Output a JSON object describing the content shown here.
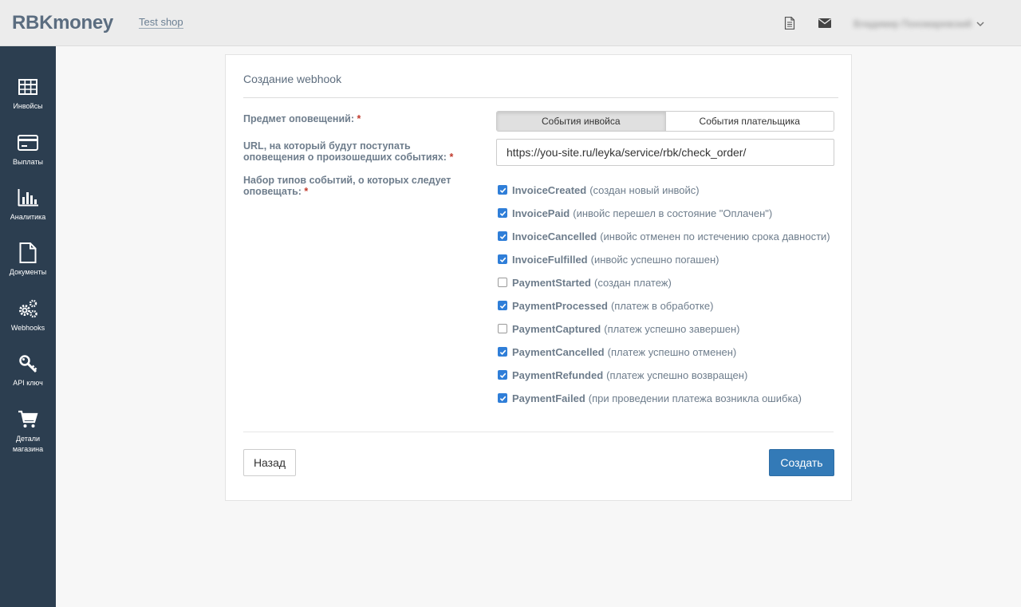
{
  "header": {
    "logo": "RBKmoney",
    "shop_link": "Test shop",
    "user_name": "Владимир Пономаревский",
    "icons": [
      "document-icon",
      "mail-icon",
      "chevron-down-icon"
    ]
  },
  "sidebar": {
    "items": [
      {
        "label": "Инвойсы",
        "icon": "table-icon"
      },
      {
        "label": "Выплаты",
        "icon": "credit-card-icon"
      },
      {
        "label": "Аналитика",
        "icon": "bar-chart-icon"
      },
      {
        "label": "Документы",
        "icon": "document-icon"
      },
      {
        "label": "Webhooks",
        "icon": "gears-icon"
      },
      {
        "label": "API ключ",
        "icon": "key-icon"
      },
      {
        "label": "Детали магазина",
        "icon": "cart-icon"
      }
    ]
  },
  "form": {
    "title": "Создание webhook",
    "subject_label": "Предмет оповещений:",
    "url_label": "URL, на который будут поступать оповещения о произошедших событиях:",
    "events_label": "Набор типов событий, о которых следует оповещать:",
    "required_mark": "*",
    "subject_options": [
      {
        "label": "События инвойса",
        "active": true
      },
      {
        "label": "События плательщика",
        "active": false
      }
    ],
    "url_value": "https://you-site.ru/leyka/service/rbk/check_order/",
    "events": [
      {
        "name": "InvoiceCreated",
        "desc": "(создан новый инвойс)",
        "checked": true
      },
      {
        "name": "InvoicePaid",
        "desc": "(инвойс перешел в состояние \"Оплачен\")",
        "checked": true
      },
      {
        "name": "InvoiceCancelled",
        "desc": "(инвойс отменен по истечению срока давности)",
        "checked": true
      },
      {
        "name": "InvoiceFulfilled",
        "desc": "(инвойс успешно погашен)",
        "checked": true
      },
      {
        "name": "PaymentStarted",
        "desc": "(создан платеж)",
        "checked": false
      },
      {
        "name": "PaymentProcessed",
        "desc": "(платеж в обработке)",
        "checked": true
      },
      {
        "name": "PaymentCaptured",
        "desc": "(платеж успешно завершен)",
        "checked": false
      },
      {
        "name": "PaymentCancelled",
        "desc": "(платеж успешно отменен)",
        "checked": true
      },
      {
        "name": "PaymentRefunded",
        "desc": "(платеж успешно возвращен)",
        "checked": true
      },
      {
        "name": "PaymentFailed",
        "desc": "(при проведении платежа возникла ошибка)",
        "checked": true
      }
    ],
    "back_label": "Назад",
    "create_label": "Создать"
  },
  "colors": {
    "sidebar_bg": "#2c3e50",
    "accent": "#337ab7",
    "checkbox": "#2f7ed8",
    "required": "#c0392b"
  }
}
